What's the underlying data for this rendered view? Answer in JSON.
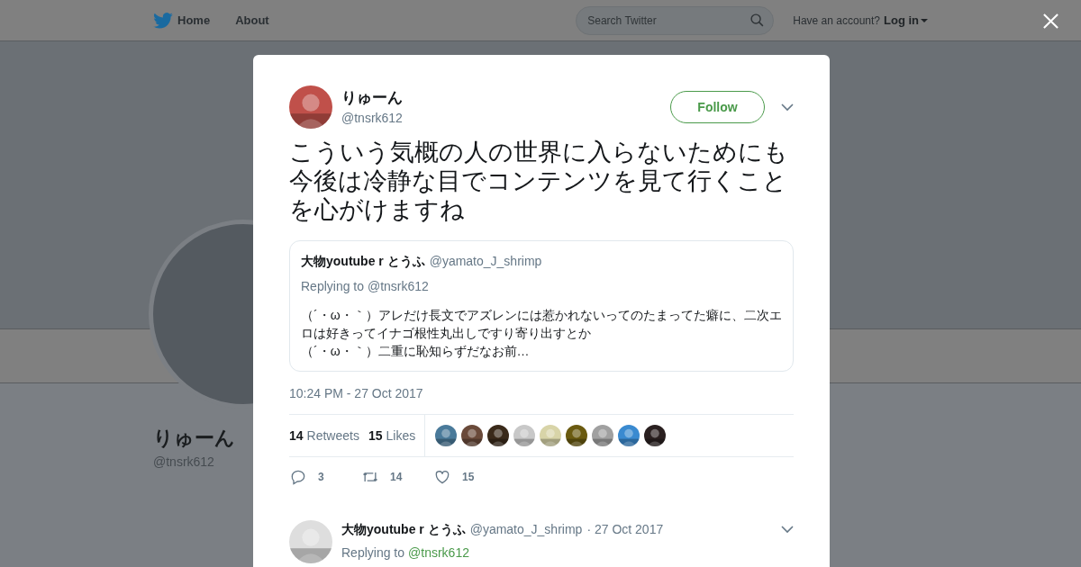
{
  "topbar": {
    "nav": [
      "Home",
      "About"
    ],
    "search": {
      "placeholder": "Search Twitter"
    },
    "account_prompt": "Have an account?",
    "login": "Log in"
  },
  "profile": {
    "name": "りゅーん",
    "handle": "@tnsrk612"
  },
  "tweet": {
    "name": "りゅーん",
    "handle": "@tnsrk612",
    "follow": "Follow",
    "text": "こういう気概の人の世界に入らないためにも今後は冷静な目でコンテンツを見て行くことを心がけますね",
    "quoted": {
      "name": "大物youtube r とうふ",
      "handle": "@yamato_J_shrimp",
      "replying": "Replying to @tnsrk612",
      "lines": [
        "（´・ω・｀）アレだけ長文でアズレンには惹かれないってのたまってた癖に、二次エロは好きってイナゴ根性丸出しですり寄り出すとか",
        "（´・ω・｀）二重に恥知らずだなお前…"
      ]
    },
    "timestamp": "10:24 PM - 27 Oct 2017",
    "stats": [
      {
        "count": "14",
        "label": "Retweets"
      },
      {
        "count": "15",
        "label": "Likes"
      }
    ],
    "likers": [
      {
        "color": "#4a7a9a"
      },
      {
        "color": "#6a4a3a"
      },
      {
        "color": "#3a2a1a"
      },
      {
        "color": "#c8c8c8"
      },
      {
        "color": "#d8d4a8"
      },
      {
        "color": "#6a5a10"
      },
      {
        "color": "#a0a0a0"
      },
      {
        "color": "#3a8ad0"
      },
      {
        "color": "#2a2020"
      }
    ],
    "actions": [
      {
        "kind": "reply",
        "count": "3"
      },
      {
        "kind": "retweet",
        "count": "14"
      },
      {
        "kind": "like",
        "count": "15"
      }
    ]
  },
  "reply": {
    "name": "大物youtube r とうふ",
    "handle": "@yamato_J_shrimp",
    "date": "· 27 Oct 2017",
    "replying_prefix": "Replying to",
    "replying_handle": "@tnsrk612"
  }
}
